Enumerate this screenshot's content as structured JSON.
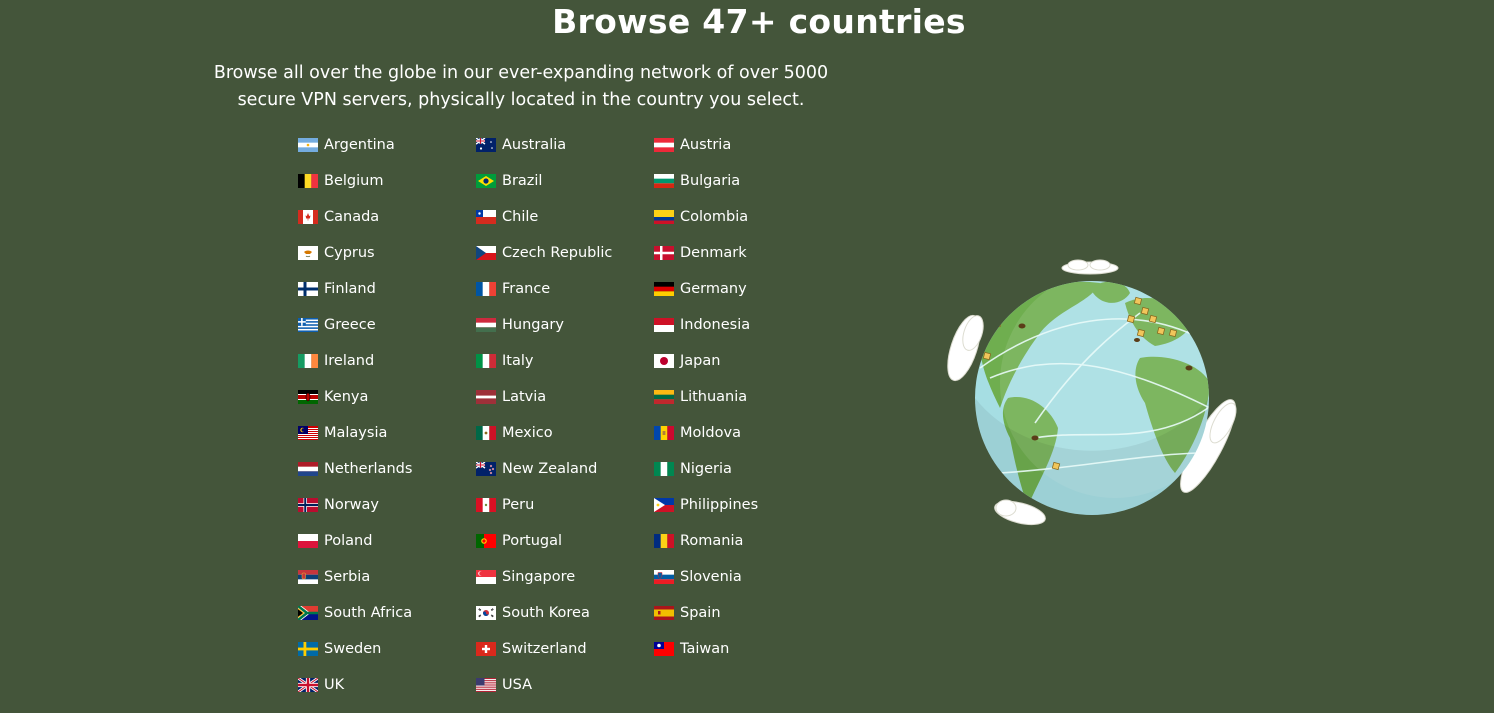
{
  "header": {
    "title": "Browse 47+ countries",
    "subtitle_line1": "Browse all over the globe in our ever-expanding network of over 5000",
    "subtitle_line2": "secure VPN servers, physically located in the country you select."
  },
  "colors": {
    "background": "#44553a",
    "text": "#ffffff",
    "ocean": "#a6dee3",
    "land": "#6fae4f",
    "cloud": "#ffffff"
  },
  "countries": [
    {
      "name": "Argentina",
      "flag": "argentina-flag-icon"
    },
    {
      "name": "Australia",
      "flag": "australia-flag-icon"
    },
    {
      "name": "Austria",
      "flag": "austria-flag-icon"
    },
    {
      "name": "Belgium",
      "flag": "belgium-flag-icon"
    },
    {
      "name": "Brazil",
      "flag": "brazil-flag-icon"
    },
    {
      "name": "Bulgaria",
      "flag": "bulgaria-flag-icon"
    },
    {
      "name": "Canada",
      "flag": "canada-flag-icon"
    },
    {
      "name": "Chile",
      "flag": "chile-flag-icon"
    },
    {
      "name": "Colombia",
      "flag": "colombia-flag-icon"
    },
    {
      "name": "Cyprus",
      "flag": "cyprus-flag-icon"
    },
    {
      "name": "Czech Republic",
      "flag": "czech-republic-flag-icon"
    },
    {
      "name": "Denmark",
      "flag": "denmark-flag-icon"
    },
    {
      "name": "Finland",
      "flag": "finland-flag-icon"
    },
    {
      "name": "France",
      "flag": "france-flag-icon"
    },
    {
      "name": "Germany",
      "flag": "germany-flag-icon"
    },
    {
      "name": "Greece",
      "flag": "greece-flag-icon"
    },
    {
      "name": "Hungary",
      "flag": "hungary-flag-icon"
    },
    {
      "name": "Indonesia",
      "flag": "indonesia-flag-icon"
    },
    {
      "name": "Ireland",
      "flag": "ireland-flag-icon"
    },
    {
      "name": "Italy",
      "flag": "italy-flag-icon"
    },
    {
      "name": "Japan",
      "flag": "japan-flag-icon"
    },
    {
      "name": "Kenya",
      "flag": "kenya-flag-icon"
    },
    {
      "name": "Latvia",
      "flag": "latvia-flag-icon"
    },
    {
      "name": "Lithuania",
      "flag": "lithuania-flag-icon"
    },
    {
      "name": "Malaysia",
      "flag": "malaysia-flag-icon"
    },
    {
      "name": "Mexico",
      "flag": "mexico-flag-icon"
    },
    {
      "name": "Moldova",
      "flag": "moldova-flag-icon"
    },
    {
      "name": "Netherlands",
      "flag": "netherlands-flag-icon"
    },
    {
      "name": "New Zealand",
      "flag": "new-zealand-flag-icon"
    },
    {
      "name": "Nigeria",
      "flag": "nigeria-flag-icon"
    },
    {
      "name": "Norway",
      "flag": "norway-flag-icon"
    },
    {
      "name": "Peru",
      "flag": "peru-flag-icon"
    },
    {
      "name": "Philippines",
      "flag": "philippines-flag-icon"
    },
    {
      "name": "Poland",
      "flag": "poland-flag-icon"
    },
    {
      "name": "Portugal",
      "flag": "portugal-flag-icon"
    },
    {
      "name": "Romania",
      "flag": "romania-flag-icon"
    },
    {
      "name": "Serbia",
      "flag": "serbia-flag-icon"
    },
    {
      "name": "Singapore",
      "flag": "singapore-flag-icon"
    },
    {
      "name": "Slovenia",
      "flag": "slovenia-flag-icon"
    },
    {
      "name": "South Africa",
      "flag": "south-africa-flag-icon"
    },
    {
      "name": "South Korea",
      "flag": "south-korea-flag-icon"
    },
    {
      "name": "Spain",
      "flag": "spain-flag-icon"
    },
    {
      "name": "Sweden",
      "flag": "sweden-flag-icon"
    },
    {
      "name": "Switzerland",
      "flag": "switzerland-flag-icon"
    },
    {
      "name": "Taiwan",
      "flag": "taiwan-flag-icon"
    },
    {
      "name": "UK",
      "flag": "uk-flag-icon"
    },
    {
      "name": "USA",
      "flag": "usa-flag-icon"
    }
  ],
  "illustration": {
    "name": "globe-illustration"
  }
}
